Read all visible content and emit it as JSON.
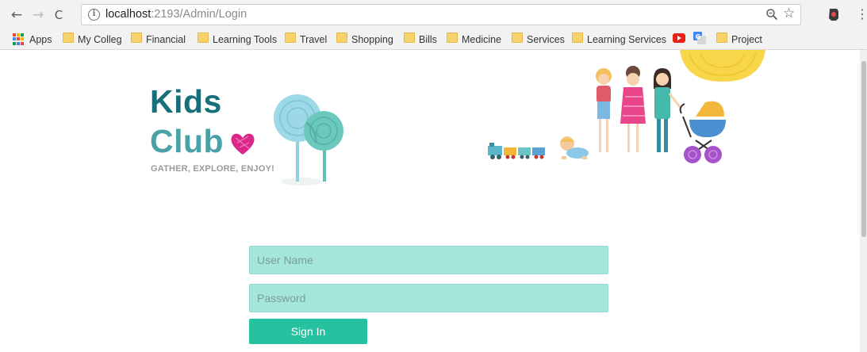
{
  "browser": {
    "url_host": "localhost",
    "url_path": ":2193/Admin/Login",
    "apps_label": "Apps",
    "bookmarks": [
      "My Colleg",
      "Financial",
      "Learning Tools",
      "Travel",
      "Shopping",
      "Bills",
      "Medicine",
      "Services",
      "Learning Services",
      "Project"
    ],
    "overflow": "»"
  },
  "page": {
    "logo_line1": "Kids",
    "logo_line2": "Club",
    "tagline": "GATHER, EXPLORE, ENJOY!",
    "username_placeholder": "User Name",
    "password_placeholder": "Password",
    "signin_label": "Sign In"
  },
  "colors": {
    "field_bg": "#a5e6dc",
    "button_bg": "#26c29f",
    "logo_dark": "#176f79",
    "logo_light": "#4aa2a6"
  }
}
